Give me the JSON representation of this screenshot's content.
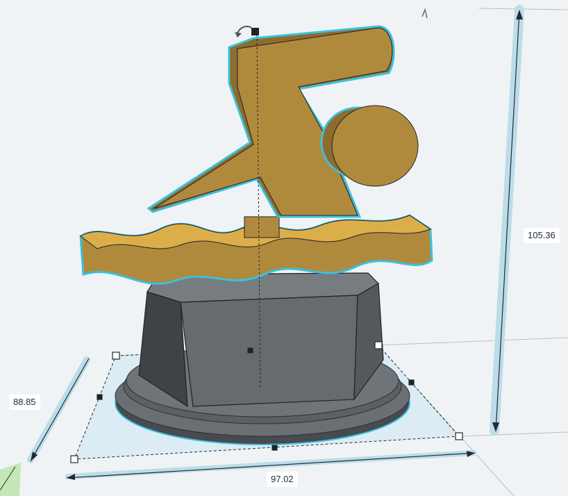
{
  "dimensions": {
    "height": "105.36",
    "depth": "88.85",
    "width": "97.02"
  },
  "colors": {
    "shape_fill": "#b08a3c",
    "shape_top": "#dcae4a",
    "shape_dark": "#7a5e25",
    "selection_outline": "#3bc0e0",
    "base_fill": "#5f6469",
    "base_dark": "#45494e",
    "workplane_shadow": "#cfe6ef",
    "dimension_bar": "#bcdce9"
  },
  "icons": {
    "rotate_handle": "rotate-arrow-icon",
    "lift_handle": "lift-cone-icon"
  }
}
